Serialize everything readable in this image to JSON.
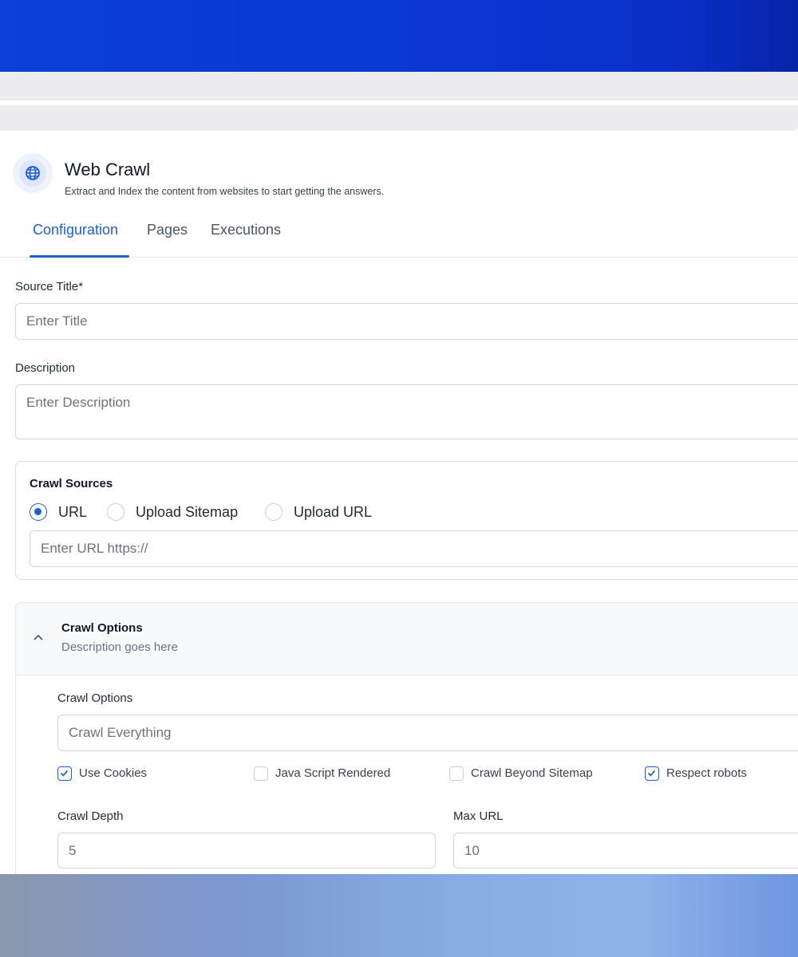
{
  "header": {
    "title": "Web Crawl",
    "subtitle": "Extract and Index the content from websites to start getting the answers.",
    "icon": "globe-icon"
  },
  "tabs": [
    {
      "label": "Configuration",
      "active": true
    },
    {
      "label": "Pages",
      "active": false
    },
    {
      "label": "Executions",
      "active": false
    }
  ],
  "form": {
    "source_title_label": "Source Title*",
    "source_title_placeholder": "Enter Title",
    "description_label": "Description",
    "description_placeholder": "Enter Description"
  },
  "crawl_sources": {
    "heading": "Crawl Sources",
    "options": [
      {
        "label": "URL",
        "selected": true
      },
      {
        "label": "Upload Sitemap",
        "selected": false
      },
      {
        "label": "Upload URL",
        "selected": false
      }
    ],
    "url_placeholder": "Enter URL https://"
  },
  "crawl_options": {
    "heading": "Crawl Options",
    "description": "Description goes here",
    "expanded": true,
    "select_label": "Crawl Options",
    "select_value": "Crawl Everything",
    "checkboxes": [
      {
        "label": "Use Cookies",
        "checked": true
      },
      {
        "label": "Java Script Rendered",
        "checked": false
      },
      {
        "label": "Crawl Beyond Sitemap",
        "checked": false
      },
      {
        "label": "Respect robots",
        "checked": true
      }
    ],
    "crawl_depth_label": "Crawl Depth",
    "crawl_depth_value": "5",
    "max_url_label": "Max URL",
    "max_url_value": "10"
  },
  "colors": {
    "accent": "#1d5fd0",
    "banner": "#0b3fd8"
  }
}
